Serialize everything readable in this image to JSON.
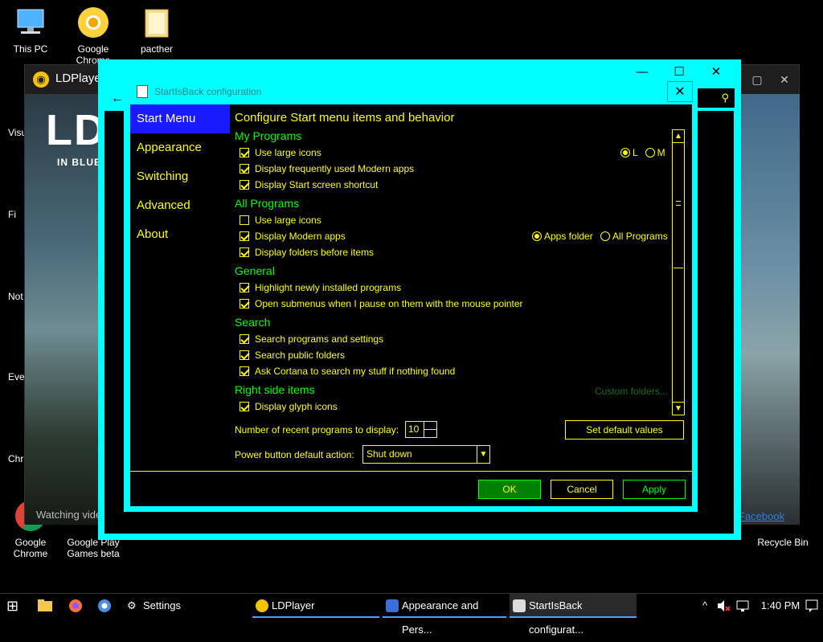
{
  "desktop": {
    "icons": [
      {
        "label": "This PC"
      },
      {
        "label": "Google Chrome"
      },
      {
        "label": "pacther"
      },
      {
        "label": "Google Chrome"
      },
      {
        "label": "Google Play Games beta"
      },
      {
        "label": "Recycle Bin"
      }
    ],
    "side_labels": [
      "Visua",
      "Fi",
      "Not",
      "Eve",
      "Chr"
    ]
  },
  "ldplayer": {
    "title": "LDPlayer",
    "art_title": "LD",
    "art_subtitle": "IN BLUE",
    "caption": "Watching vide",
    "link": "Facebook",
    "min_icon": "▢",
    "close_icon": "✕"
  },
  "outer_window": {
    "min_icon": "—",
    "max_icon": "☐",
    "close_icon": "✕",
    "back_icon": "←",
    "search_icon": "⚲"
  },
  "dialog": {
    "title": "StartIsBack configuration",
    "close_icon": "✕",
    "nav": [
      "Start Menu",
      "Appearance",
      "Switching",
      "Advanced",
      "About"
    ],
    "heading": "Configure Start menu items and behavior",
    "sections": {
      "my_programs": {
        "title": "My Programs",
        "items": [
          {
            "label": "Use large icons",
            "checked": true
          },
          {
            "label": "Display frequently used Modern apps",
            "checked": true
          },
          {
            "label": "Display Start screen shortcut",
            "checked": true
          }
        ],
        "radios": [
          {
            "label": "L",
            "selected": true
          },
          {
            "label": "M",
            "selected": false
          }
        ]
      },
      "all_programs": {
        "title": "All Programs",
        "items": [
          {
            "label": "Use large icons",
            "checked": false
          },
          {
            "label": "Display Modern apps",
            "checked": true
          },
          {
            "label": "Display folders before items",
            "checked": true
          }
        ],
        "radios": [
          {
            "label": "Apps folder",
            "selected": true
          },
          {
            "label": "All Programs",
            "selected": false
          }
        ]
      },
      "general": {
        "title": "General",
        "items": [
          {
            "label": "Highlight newly installed programs",
            "checked": true
          },
          {
            "label": "Open submenus when I pause on them with the mouse pointer",
            "checked": true
          }
        ]
      },
      "search": {
        "title": "Search",
        "items": [
          {
            "label": "Search programs and settings",
            "checked": true
          },
          {
            "label": "Search public folders",
            "checked": true
          },
          {
            "label": "Ask Cortana to search my stuff if nothing found",
            "checked": true
          }
        ]
      },
      "right_side": {
        "title": "Right side items",
        "custom_folders": "Custom folders...",
        "items": [
          {
            "label": "Display glyph icons",
            "checked": true
          }
        ]
      }
    },
    "recent_label": "Number of recent programs to display:",
    "recent_value": "10",
    "set_default": "Set default values",
    "power_label": "Power button default action:",
    "power_value": "Shut down",
    "buttons": {
      "ok": "OK",
      "cancel": "Cancel",
      "apply": "Apply"
    },
    "scroll_up": "▲",
    "scroll_down": "▼",
    "dropdown_icon": "▼"
  },
  "taskbar": {
    "start_icon": "⊞",
    "tasks": [
      {
        "label": "Settings",
        "icon": "gear-icon"
      },
      {
        "label": "LDPlayer",
        "icon": "ldplayer-icon"
      },
      {
        "label": "Appearance and Pers...",
        "icon": "control-panel-icon"
      },
      {
        "label": "StartIsBack configurat...",
        "icon": "startisback-icon"
      }
    ],
    "tray_chevron": "^",
    "time": "1:40 PM"
  },
  "colors": {
    "accent": "#00ffff",
    "text": "#ffff00",
    "section": "#00ff00",
    "nav_active": "#1a1aff"
  }
}
